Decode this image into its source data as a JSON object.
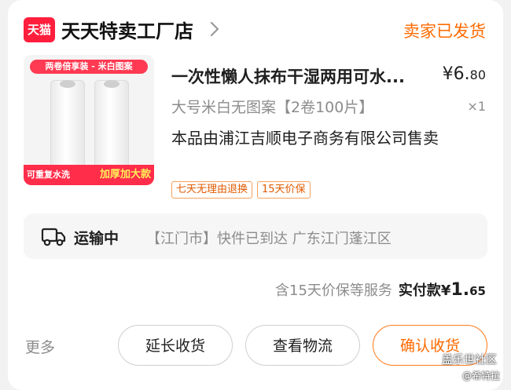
{
  "store": {
    "badge": "天猫",
    "name": "天天特卖工厂店",
    "status": "卖家已发货"
  },
  "product": {
    "image_ribbon": "两卷倍享装 - 米白图案",
    "image_banner_left": "可重复水洗",
    "image_banner_right": "加厚加大款",
    "title": "一次性懒人抹布干湿两用可水...",
    "price_main": "¥6.",
    "price_cents": "80",
    "spec": "大号米白无图案【2卷100片】",
    "qty": "×1",
    "seller_note": "本品由浦江吉顺电子商务有限公司售卖",
    "tags": [
      "七天无理由退换",
      "15天价保"
    ]
  },
  "logistics": {
    "status": "运输中",
    "detail": "【江门市】快件已到达 广东江门蓬江区"
  },
  "payment": {
    "service": "含15天价保等服务",
    "label": "实付款",
    "currency": "¥",
    "amount_int": "1.",
    "amount_cents": "65"
  },
  "actions": {
    "more": "更多",
    "extend": "延长收货",
    "view_logistics": "查看物流",
    "confirm": "确认收货"
  },
  "watermark": {
    "line1": "盖乐世社区",
    "line2": "@希特拉"
  },
  "colors": {
    "accent": "#ff6a00",
    "tmall_red": "#ff1f3d"
  }
}
